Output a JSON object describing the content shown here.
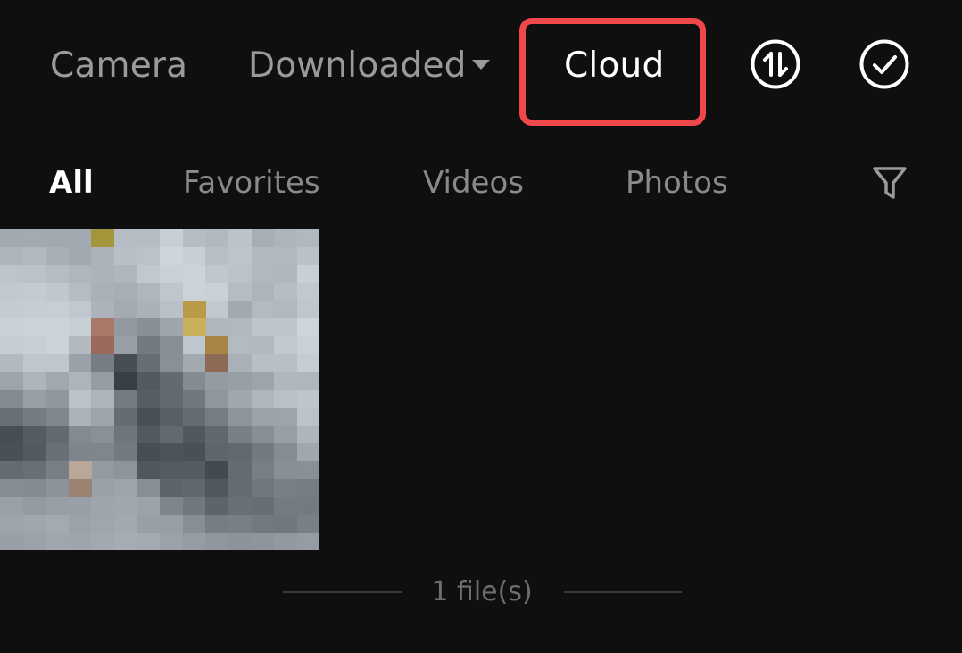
{
  "source_tabs": {
    "camera": "Camera",
    "downloaded": "Downloaded",
    "cloud": "Cloud"
  },
  "icons": {
    "sync": "upload-download-sync-icon",
    "select": "select-check-icon",
    "filter": "filter-funnel-icon",
    "dropdown": "caret-down-icon"
  },
  "filter_tabs": {
    "all": "All",
    "favorites": "Favorites",
    "videos": "Videos",
    "photos": "Photos"
  },
  "footer": {
    "count": "1 file(s)"
  },
  "colors": {
    "background": "#0f0f0f",
    "active": "#ffffff",
    "inactive": "#9a9a9a",
    "highlight": "#f0474a"
  }
}
